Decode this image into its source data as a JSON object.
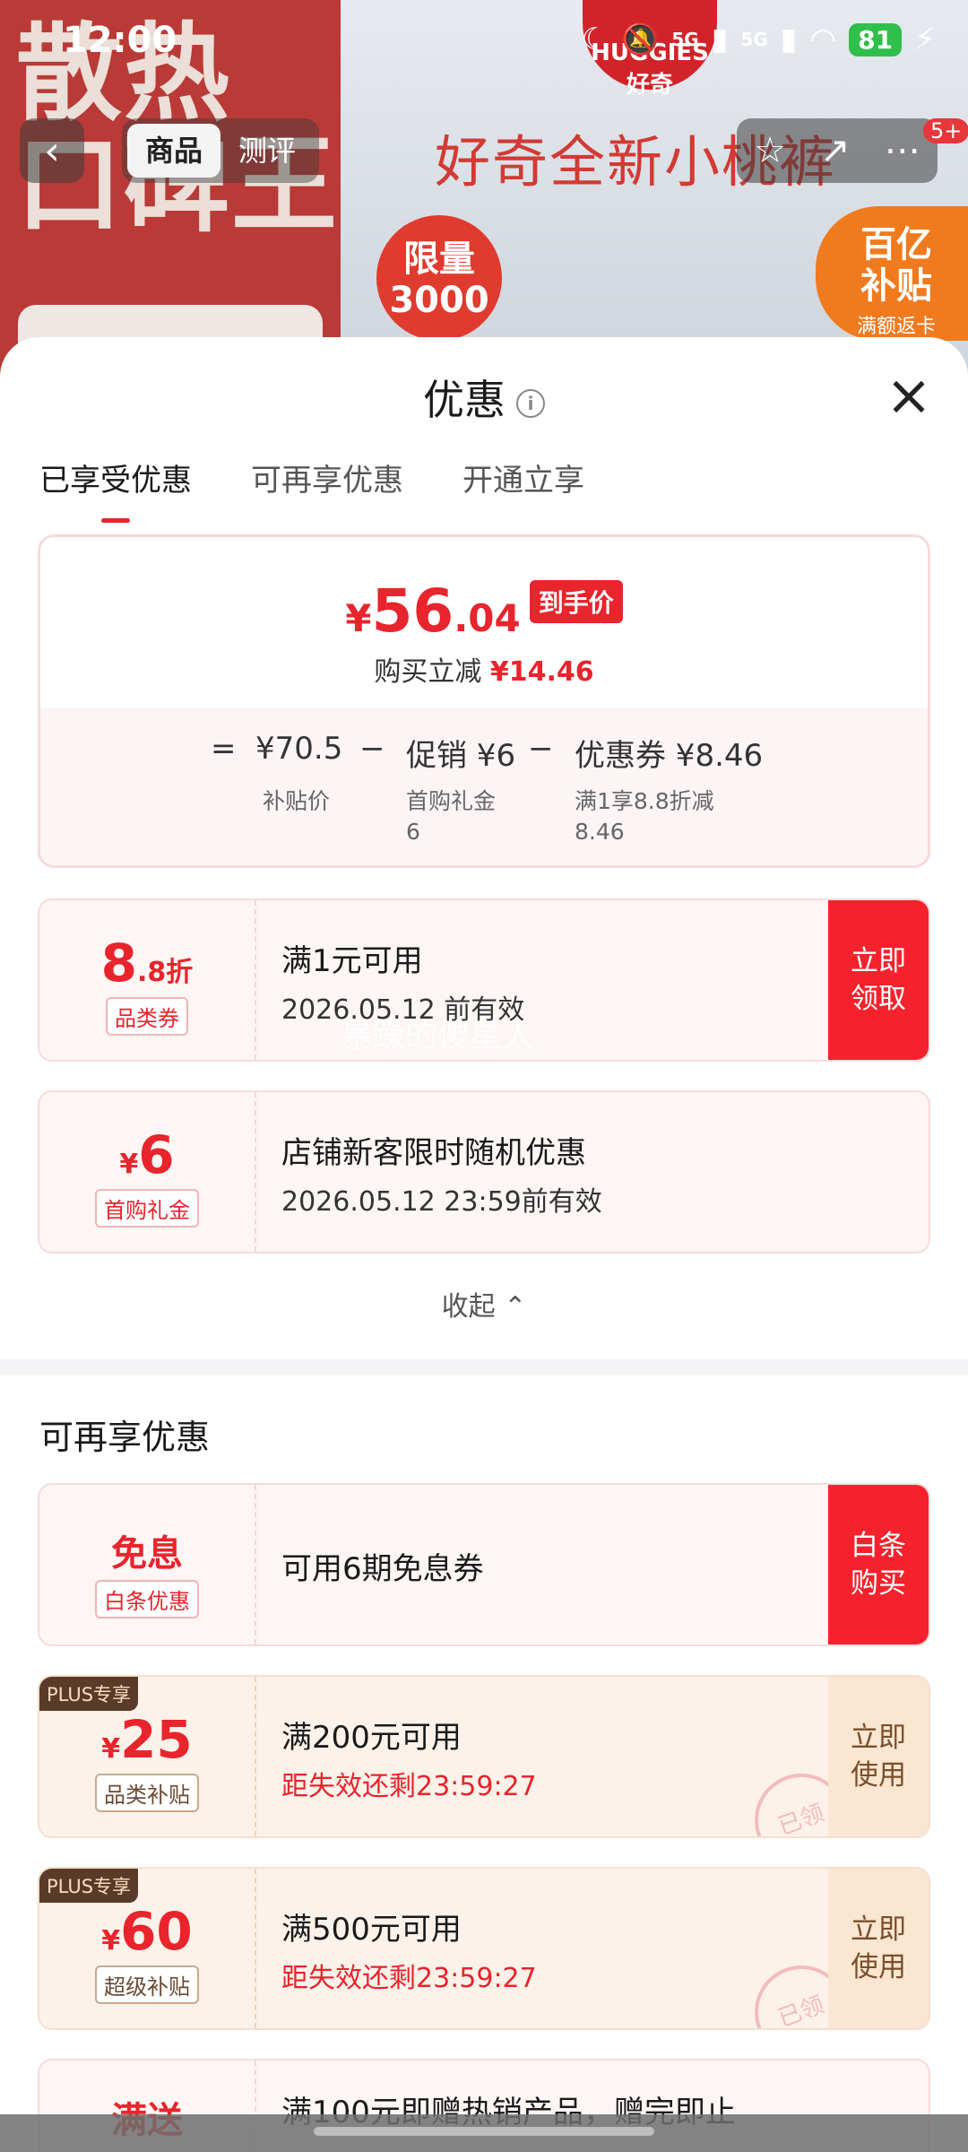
{
  "status_bar": {
    "time": "12:00",
    "network": "5G",
    "battery": "81"
  },
  "background": {
    "left_text": "散热\n口碑王",
    "logo": "HUGGIES 好奇",
    "slogan": "好奇全新小桃裤",
    "badge": "限量\n3000",
    "butie_title": "百亿\n补贴",
    "butie_sub": "满额返卡"
  },
  "nav": {
    "tabs": [
      {
        "label": "商品",
        "active": true
      },
      {
        "label": "测评",
        "active": false
      }
    ],
    "message_count": "5+"
  },
  "sheet": {
    "title": "优惠",
    "tabs": [
      {
        "label": "已享受优惠",
        "active": true
      },
      {
        "label": "可再享优惠",
        "active": false
      },
      {
        "label": "开通立享",
        "active": false
      }
    ],
    "price": {
      "yen": "¥",
      "integer": "56",
      "decimal": ".04",
      "tag": "到手价",
      "sub_label": "购买立减",
      "sub_value": "¥14.46"
    },
    "formula": {
      "equals": "=",
      "base": "¥70.5",
      "base_note": "补贴价",
      "minus1": "−",
      "promo": "促销 ¥6",
      "promo_note": "首购礼金\n6",
      "minus2": "−",
      "coupon": "优惠券 ¥8.46",
      "coupon_note": "满1享8.8折减\n8.46"
    },
    "coupons_applied": [
      {
        "big": "8",
        "small": ".8折",
        "chip": "品类券",
        "t1": "满1元可用",
        "t2": "2026.05.12 前有效",
        "btn": "立即\n领取"
      },
      {
        "big": "6",
        "prefix": "¥",
        "chip": "首购礼金",
        "t1": "店铺新客限时随机优惠",
        "t2": "2026.05.12 23:59前有效"
      }
    ],
    "collapse": "收起 ⌃",
    "watermark": "暴躁的傻星人",
    "section_title": "可再享优惠",
    "coupons_more": [
      {
        "big": "免息",
        "chip": "白条优惠",
        "t1": "可用6期免息券",
        "btn": "白条\n购买"
      },
      {
        "plus": "PLUS专享",
        "prefix": "¥",
        "big": "25",
        "chip": "品类补贴",
        "t1": "满200元可用",
        "t2": "距失效还剩23:59:27",
        "btn": "立即\n使用",
        "stamp": "已领"
      },
      {
        "plus": "PLUS专享",
        "prefix": "¥",
        "big": "60",
        "chip": "超级补贴",
        "t1": "满500元可用",
        "t2": "距失效还剩23:59:27",
        "btn": "立即\n使用",
        "stamp": "已领"
      },
      {
        "big": "满送",
        "t1": "满100元即赠热销产品，赠完即止"
      }
    ]
  },
  "colors": {
    "accent": "#e8242c",
    "plus_badge": "#5a3a28"
  }
}
